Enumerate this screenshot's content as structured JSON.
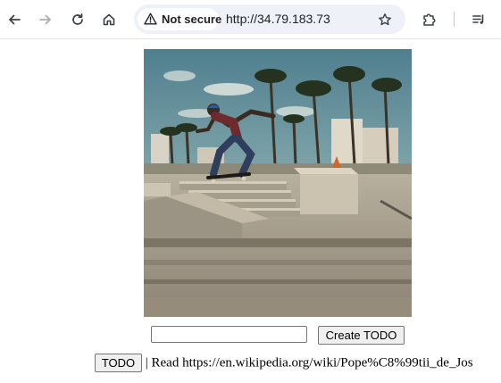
{
  "browser": {
    "security_label": "Not secure",
    "url": "http://34.79.183.73",
    "icons": [
      "back-icon",
      "forward-icon",
      "reload-icon",
      "home-icon",
      "warning-icon",
      "star-icon",
      "extensions-icon",
      "reading-list-icon"
    ]
  },
  "page": {
    "image_alt": "Skateboarder jumping at a skatepark with palm trees",
    "input": {
      "value": "",
      "placeholder": ""
    },
    "create_button_label": "Create TODO",
    "todos": [
      {
        "button_label": "TODO",
        "text": " | Read https://en.wikipedia.org/wiki/Pope%C8%99tii_de_Jos"
      }
    ]
  },
  "colors": {
    "toolbar_bg": "#ffffff",
    "omnibox_bg": "#eef1f7",
    "button_bg": "#efefef"
  }
}
